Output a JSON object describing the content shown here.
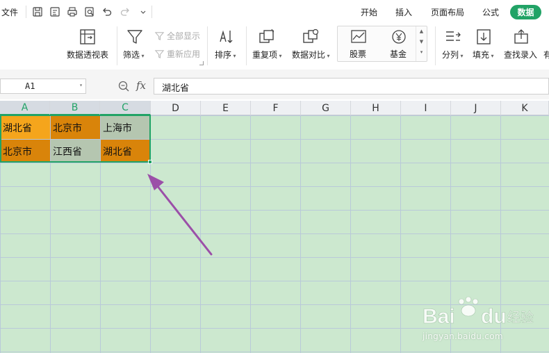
{
  "quickbar": {
    "file_menu": "文件",
    "tabs": [
      "开始",
      "插入",
      "页面布局",
      "公式"
    ],
    "active_tab": "数据"
  },
  "ribbon": {
    "pivot_table": "数据透视表",
    "filter": "筛选",
    "show_all": "全部显示",
    "reapply": "重新应用",
    "sort": "排序",
    "duplicates": "重复项",
    "compare": "数据对比",
    "stocks": "股票",
    "fund": "基金",
    "split": "分列",
    "fill": "填充",
    "find_entry": "查找录入",
    "cut_off_label": "有"
  },
  "formula_bar": {
    "name_box": "A1",
    "fx_label": "fx",
    "formula": "湖北省"
  },
  "columns": [
    "A",
    "B",
    "C",
    "D",
    "E",
    "F",
    "G",
    "H",
    "I",
    "J",
    "K"
  ],
  "selected_columns": [
    "A",
    "B",
    "C"
  ],
  "cells": {
    "r1": [
      {
        "col": "A",
        "value": "湖北省",
        "fill": "#f5a51c"
      },
      {
        "col": "B",
        "value": "北京市",
        "fill": "#d9840a"
      },
      {
        "col": "C",
        "value": "上海市",
        "fill": "#b5c6b0"
      }
    ],
    "r2": [
      {
        "col": "A",
        "value": "北京市",
        "fill": "#d9840a"
      },
      {
        "col": "B",
        "value": "江西省",
        "fill": "#b5c6b0"
      },
      {
        "col": "C",
        "value": "湖北省",
        "fill": "#d9840a"
      }
    ]
  },
  "colors": {
    "accent": "#21a366",
    "sheet_bg": "#cce8cf",
    "arrow": "#9b4fa8"
  },
  "watermark": {
    "logo": "Baidu经验",
    "url": "jingyan.baidu.com"
  }
}
